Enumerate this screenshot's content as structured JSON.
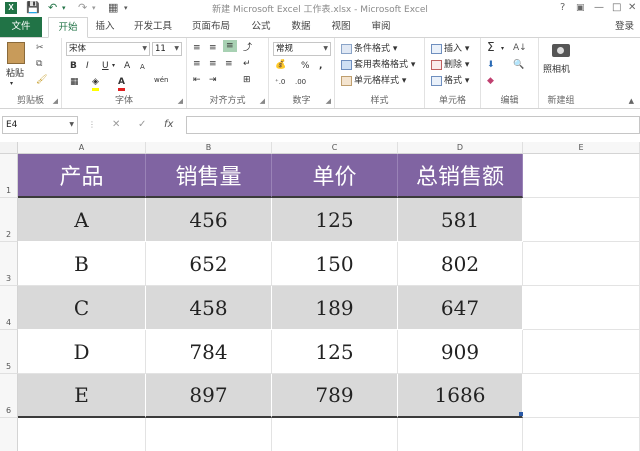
{
  "app": {
    "title": "新建 Microsoft Excel 工作表.xlsx - Microsoft Excel",
    "logo_letter": "X",
    "accent_color": "#217346"
  },
  "window_controls": {
    "help": "?",
    "restore": "▣",
    "minimize": "—",
    "maximize": "□",
    "close": "✕"
  },
  "quick_access": [
    "save-icon",
    "undo-icon",
    "redo-icon",
    "customize-icon"
  ],
  "tabs": {
    "file": "文件",
    "items": [
      "开始",
      "插入",
      "开发工具",
      "页面布局",
      "公式",
      "数据",
      "视图",
      "审阅"
    ],
    "active": "开始",
    "login": "登录"
  },
  "ribbon": {
    "clipboard": {
      "paste": "粘贴",
      "label": "剪贴板"
    },
    "font": {
      "name": "宋体",
      "size": "11",
      "label": "字体",
      "bold": "B",
      "italic": "I",
      "underline": "U",
      "wen": "wén",
      "font_color_letter": "A",
      "grow": "A",
      "shrink": "A"
    },
    "alignment": {
      "label": "对齐方式"
    },
    "number": {
      "format": "常规",
      "label": "数字",
      "percent": "%",
      "comma": ","
    },
    "styles": {
      "conditional": "条件格式",
      "table_format": "套用表格格式",
      "cell_style": "单元格样式",
      "label": "样式"
    },
    "cells": {
      "insert": "插入",
      "delete": "删除",
      "format": "格式",
      "label": "单元格"
    },
    "editing": {
      "sum": "Σ",
      "label": "编辑"
    },
    "new_group": {
      "camera": "照相机",
      "label": "新建组"
    }
  },
  "formula_bar": {
    "name_box": "E4",
    "cancel": "✕",
    "enter": "✓",
    "fx": "fx",
    "content": ""
  },
  "columns": [
    "A",
    "B",
    "C",
    "D",
    "E"
  ],
  "rows": [
    "1",
    "2",
    "3",
    "4",
    "5",
    "6"
  ],
  "table": {
    "headers": [
      "产品",
      "销售量",
      "单价",
      "总销售额"
    ],
    "rows": [
      [
        "A",
        "456",
        "125",
        "581"
      ],
      [
        "B",
        "652",
        "150",
        "802"
      ],
      [
        "C",
        "458",
        "189",
        "647"
      ],
      [
        "D",
        "784",
        "125",
        "909"
      ],
      [
        "E",
        "897",
        "789",
        "1686"
      ]
    ],
    "header_color": "#8064a2",
    "band_color": "#d9d9d9"
  }
}
